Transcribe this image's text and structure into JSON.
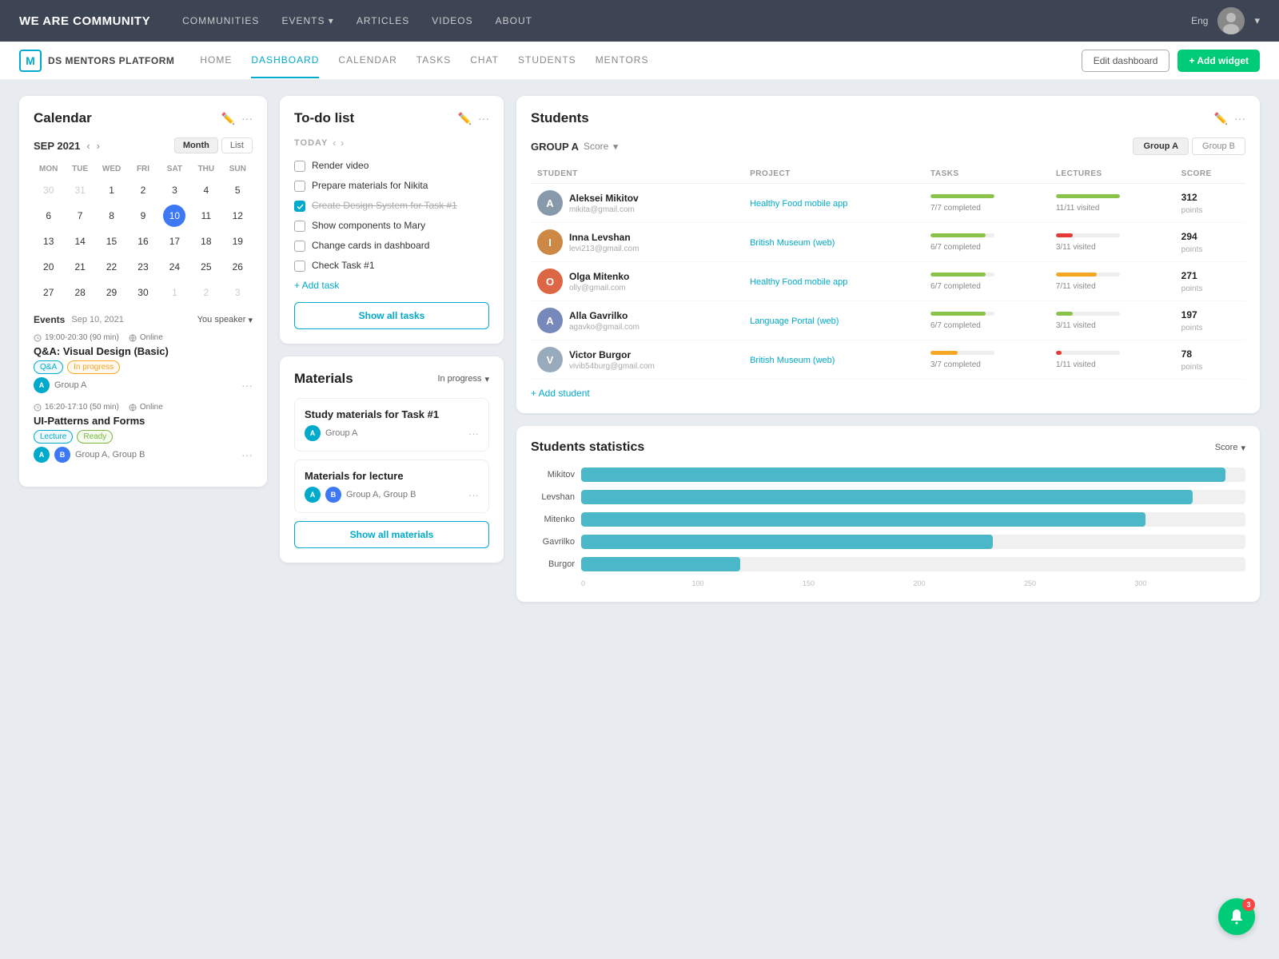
{
  "topNav": {
    "brand": "WE ARE COMMUNITY",
    "links": [
      {
        "label": "CoMMunItIeS",
        "hasArrow": false
      },
      {
        "label": "EVENTS",
        "hasArrow": true
      },
      {
        "label": "ARTICLES",
        "hasArrow": false
      },
      {
        "label": "VIDEOS",
        "hasArrow": false
      },
      {
        "label": "ABOUT",
        "hasArrow": false
      }
    ],
    "lang": "Eng"
  },
  "subNav": {
    "logoLetter": "M",
    "platformName": "DS MENTORS PLATFORM",
    "links": [
      {
        "label": "HOME",
        "active": false
      },
      {
        "label": "DASHBOARD",
        "active": true
      },
      {
        "label": "CALENDAR",
        "active": false
      },
      {
        "label": "TASKS",
        "active": false
      },
      {
        "label": "CHAT",
        "active": false
      },
      {
        "label": "STUDENTS",
        "active": false
      },
      {
        "label": "MENTORS",
        "active": false
      }
    ],
    "editBtn": "Edit dashboard",
    "addBtn": "+ Add widget"
  },
  "calendar": {
    "title": "Calendar",
    "month": "SEP 2021",
    "viewMonth": "Month",
    "viewList": "List",
    "dayHeaders": [
      "MON",
      "TUE",
      "WED",
      "FRI",
      "SAT",
      "THU",
      "SUN"
    ],
    "weeks": [
      [
        {
          "d": "30",
          "o": true
        },
        {
          "d": "31",
          "o": true
        },
        {
          "d": "1"
        },
        {
          "d": "2"
        },
        {
          "d": "3"
        },
        {
          "d": "4"
        },
        {
          "d": "5"
        }
      ],
      [
        {
          "d": "6"
        },
        {
          "d": "7"
        },
        {
          "d": "8"
        },
        {
          "d": "9"
        },
        {
          "d": "10",
          "today": true
        },
        {
          "d": "11"
        },
        {
          "d": "12"
        }
      ],
      [
        {
          "d": "13"
        },
        {
          "d": "14"
        },
        {
          "d": "15"
        },
        {
          "d": "16"
        },
        {
          "d": "17"
        },
        {
          "d": "18"
        },
        {
          "d": "19"
        }
      ],
      [
        {
          "d": "20"
        },
        {
          "d": "21"
        },
        {
          "d": "22"
        },
        {
          "d": "23"
        },
        {
          "d": "24"
        },
        {
          "d": "25"
        },
        {
          "d": "26"
        }
      ],
      [
        {
          "d": "27"
        },
        {
          "d": "28"
        },
        {
          "d": "29"
        },
        {
          "d": "30"
        },
        {
          "d": "1",
          "o": true
        },
        {
          "d": "2",
          "o": true
        },
        {
          "d": "3",
          "o": true
        }
      ]
    ],
    "eventsLabel": "Events",
    "eventsDate": "Sep 10, 2021",
    "eventsFilter": "You speaker",
    "events": [
      {
        "time": "19:00-20:30 (90 min)",
        "location": "Online",
        "title": "Q&A: Visual Design (Basic)",
        "tags": [
          {
            "label": "Q&A",
            "type": "qa"
          },
          {
            "label": "In progress",
            "type": "inprogress"
          }
        ],
        "groups": [
          {
            "letter": "A",
            "color": "cyan",
            "name": "Group A"
          }
        ],
        "dots": "···"
      },
      {
        "time": "16:20-17:10 (50 min)",
        "location": "Online",
        "title": "UI-Patterns and Forms",
        "tags": [
          {
            "label": "Lecture",
            "type": "lecture"
          },
          {
            "label": "Ready",
            "type": "ready"
          }
        ],
        "groups": [
          {
            "letter": "A",
            "color": "cyan"
          },
          {
            "letter": "B",
            "color": "blue"
          }
        ],
        "groupName": "Group A, Group B",
        "dots": "···"
      }
    ]
  },
  "todo": {
    "title": "To-do list",
    "todayLabel": "TODAY",
    "tasks": [
      {
        "text": "Render video",
        "checked": false,
        "strikethrough": false
      },
      {
        "text": "Prepare materials for Nikita",
        "checked": false,
        "strikethrough": false
      },
      {
        "text": "Create Design System for Task #1",
        "checked": true,
        "strikethrough": true
      },
      {
        "text": "Show components to Mary",
        "checked": false,
        "strikethrough": false
      },
      {
        "text": "Change cards in dashboard",
        "checked": false,
        "strikethrough": false
      },
      {
        "text": "Check Task #1",
        "checked": false,
        "strikethrough": false
      }
    ],
    "addTask": "+ Add task",
    "showAll": "Show all tasks"
  },
  "materials": {
    "title": "Materials",
    "filter": "In progress",
    "items": [
      {
        "title": "Study materials for Task #1",
        "groupLetter": "A",
        "groupColor": "cyan",
        "groupName": "Group A",
        "dots": "···"
      },
      {
        "title": "Materials for lecture",
        "groupLetters": [
          "A",
          "B"
        ],
        "groupColors": [
          "cyan",
          "blue"
        ],
        "groupName": "Group A, Group B",
        "dots": "···"
      }
    ],
    "showAll": "Show all materials"
  },
  "students": {
    "title": "Students",
    "groupLabel": "GROUP A",
    "scoreLabel": "Score",
    "tabs": [
      {
        "label": "Group A",
        "active": true
      },
      {
        "label": "Group B",
        "active": false
      }
    ],
    "columns": [
      "STUDENT",
      "PROJECT",
      "TASKS",
      "LECTURES",
      "SCORE"
    ],
    "rows": [
      {
        "name": "Aleksei Mikitov",
        "email": "mikita@gmail.com",
        "avatarColor": "#8899aa",
        "avatarLetter": "A",
        "project": "Healthy Food mobile app",
        "projectColor": "#00aacc",
        "tasksBar": 100,
        "tasksBarColor": "#8bc34a",
        "tasksStat": "7/7 completed",
        "lecturesBar": 100,
        "lecturesBarColor": "#8bc34a",
        "lecturesStat": "11/11 visited",
        "score": "312",
        "scoreLabel": "points"
      },
      {
        "name": "Inna Levshan",
        "email": "levi213@gmail.com",
        "avatarColor": "#cc8844",
        "avatarLetter": "I",
        "project": "British Museum (web)",
        "projectColor": "#00aacc",
        "tasksBar": 86,
        "tasksBarColor": "#8bc34a",
        "tasksStat": "6/7 completed",
        "lecturesBar": 27,
        "lecturesBarColor": "#e53935",
        "lecturesStat": "3/11 visited",
        "score": "294",
        "scoreLabel": "points"
      },
      {
        "name": "Olga Mitenko",
        "email": "olly@gmail.com",
        "avatarColor": "#dd6644",
        "avatarLetter": "O",
        "project": "Healthy Food mobile app",
        "projectColor": "#00aacc",
        "tasksBar": 86,
        "tasksBarColor": "#8bc34a",
        "tasksStat": "6/7 completed",
        "lecturesBar": 64,
        "lecturesBarColor": "#f5a623",
        "lecturesStat": "7/11 visited",
        "score": "271",
        "scoreLabel": "points"
      },
      {
        "name": "Alla Gavrilko",
        "email": "agavko@gmail.com",
        "avatarColor": "#7788bb",
        "avatarLetter": "A",
        "project": "Language Portal (web)",
        "projectColor": "#00aacc",
        "tasksBar": 86,
        "tasksBarColor": "#8bc34a",
        "tasksStat": "6/7 completed",
        "lecturesBar": 27,
        "lecturesBarColor": "#8bc34a",
        "lecturesStat": "3/11 visited",
        "score": "197",
        "scoreLabel": "points"
      },
      {
        "name": "Victor Burgor",
        "email": "vivib54burg@gmail.com",
        "avatarColor": "#99aabb",
        "avatarLetter": "V",
        "project": "British Museum (web)",
        "projectColor": "#00aacc",
        "tasksBar": 43,
        "tasksBarColor": "#f5a623",
        "tasksStat": "3/7 completed",
        "lecturesBar": 9,
        "lecturesBarColor": "#e53935",
        "lecturesStat": "1/11 visited",
        "score": "78",
        "scoreLabel": "points"
      }
    ],
    "addStudent": "+ Add student"
  },
  "statistics": {
    "title": "Students statistics",
    "filter": "Score",
    "bars": [
      {
        "label": "Mikitov",
        "value": 312,
        "max": 320,
        "pct": 97
      },
      {
        "label": "Levshan",
        "value": 294,
        "max": 320,
        "pct": 92
      },
      {
        "label": "Mitenko",
        "value": 271,
        "max": 320,
        "pct": 85
      },
      {
        "label": "Gavrilko",
        "value": 197,
        "max": 320,
        "pct": 62
      },
      {
        "label": "Burgor",
        "value": 78,
        "max": 320,
        "pct": 24
      }
    ],
    "axisTicks": [
      "0",
      "100",
      "150",
      "200",
      "250",
      "300"
    ]
  },
  "notification": {
    "count": "3"
  }
}
